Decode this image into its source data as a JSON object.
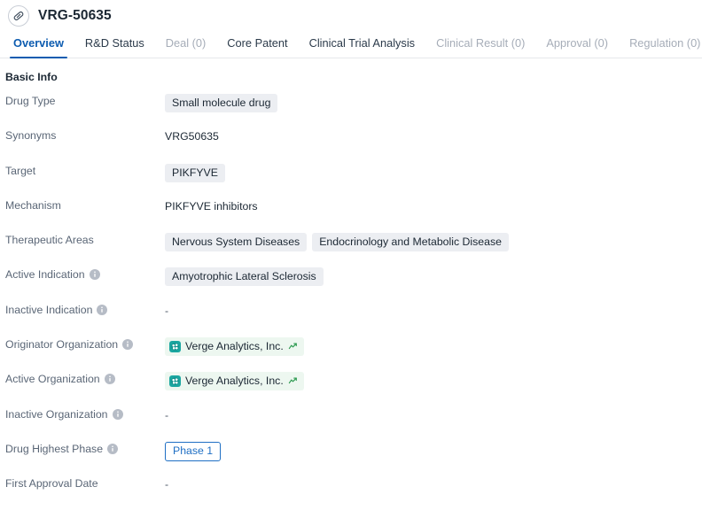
{
  "header": {
    "icon": "pill-capsule-icon",
    "title": "VRG-50635"
  },
  "tabs": [
    {
      "label": "Overview",
      "state": "active"
    },
    {
      "label": "R&D Status",
      "state": "normal"
    },
    {
      "label": "Deal (0)",
      "state": "disabled"
    },
    {
      "label": "Core Patent",
      "state": "normal"
    },
    {
      "label": "Clinical Trial Analysis",
      "state": "normal"
    },
    {
      "label": "Clinical Result (0)",
      "state": "disabled"
    },
    {
      "label": "Approval (0)",
      "state": "disabled"
    },
    {
      "label": "Regulation (0)",
      "state": "disabled"
    }
  ],
  "basic_info": {
    "section_title": "Basic Info",
    "rows": [
      {
        "label": "Drug Type",
        "info": false,
        "type": "chips",
        "values": [
          "Small molecule drug"
        ]
      },
      {
        "label": "Synonyms",
        "info": false,
        "type": "text",
        "values": [
          "VRG50635"
        ]
      },
      {
        "label": "Target",
        "info": false,
        "type": "chips",
        "values": [
          "PIKFYVE"
        ]
      },
      {
        "label": "Mechanism",
        "info": false,
        "type": "text",
        "values": [
          "PIKFYVE inhibitors"
        ]
      },
      {
        "label": "Therapeutic Areas",
        "info": false,
        "type": "chips",
        "values": [
          "Nervous System Diseases",
          "Endocrinology and Metabolic Disease"
        ]
      },
      {
        "label": "Active Indication",
        "info": true,
        "type": "chips",
        "values": [
          "Amyotrophic Lateral Sclerosis"
        ]
      },
      {
        "label": "Inactive Indication",
        "info": true,
        "type": "empty",
        "values": [
          "-"
        ]
      },
      {
        "label": "Originator Organization",
        "info": true,
        "type": "orgs",
        "values": [
          "Verge Analytics, Inc."
        ]
      },
      {
        "label": "Active Organization",
        "info": true,
        "type": "orgs",
        "values": [
          "Verge Analytics, Inc."
        ]
      },
      {
        "label": "Inactive Organization",
        "info": true,
        "type": "empty",
        "values": [
          "-"
        ]
      },
      {
        "label": "Drug Highest Phase",
        "info": true,
        "type": "phase",
        "values": [
          "Phase 1"
        ]
      },
      {
        "label": "First Approval Date",
        "info": false,
        "type": "empty",
        "values": [
          "-"
        ]
      }
    ]
  },
  "colors": {
    "accent_blue": "#0d5cb0",
    "phase_blue": "#1f6fc4",
    "chip_gray": "#eceef2",
    "org_chip_green": "#edf7f0",
    "org_logo_teal": "#1aa6a0",
    "trend_green": "#2e9b52",
    "label_gray": "#5a6676",
    "disabled_gray": "#a6adb8"
  },
  "icons": {
    "info": "info-circle-icon",
    "trend": "trend-up-icon",
    "org_logo": "company-logo-icon",
    "header": "pill-capsule-icon"
  }
}
